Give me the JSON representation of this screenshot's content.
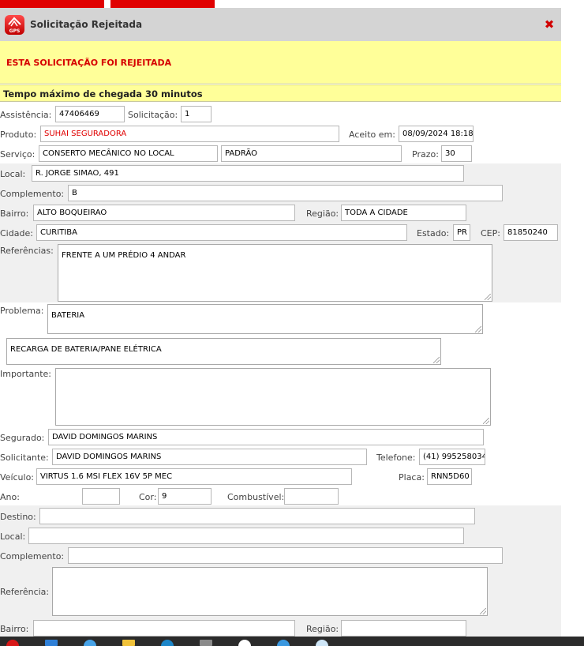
{
  "window": {
    "title": "Solicitação Rejeitada",
    "icon": "gps-app-icon",
    "icon_text": "GPS"
  },
  "alert": "ESTA SOLICITAÇÃO FOI REJEITADA",
  "tempo": "Tempo máximo de chegada 30 minutos",
  "labels": {
    "assistencia": "Assistência:",
    "solicitacao": "Solicitação:",
    "produto": "Produto:",
    "aceito": "Aceito em:",
    "servico": "Serviço:",
    "prazo": "Prazo:",
    "local": "Local:",
    "complemento": "Complemento:",
    "bairro": "Bairro:",
    "regiao": "Região:",
    "cidade": "Cidade:",
    "estado": "Estado:",
    "cep": "CEP:",
    "referencias": "Referências:",
    "problema": "Problema:",
    "importante": "Importante:",
    "segurado": "Segurado:",
    "solicitante": "Solicitante:",
    "telefone": "Telefone:",
    "veiculo": "Veículo:",
    "placa": "Placa:",
    "ano": "Ano:",
    "cor": "Cor:",
    "combustivel": "Combustível:",
    "destino": "Destino:",
    "local2": "Local:",
    "complemento2": "Complemento:",
    "referencia2": "Referência:",
    "bairro2": "Bairro:",
    "regiao2": "Região:"
  },
  "values": {
    "assistencia": "47406469",
    "solicitacao": "1",
    "produto": "SUHAI SEGURADORA",
    "aceito": "08/09/2024 18:18",
    "servico": "CONSERTO MECÂNICO NO LOCAL",
    "servico_tipo": "PADRÃO",
    "prazo": "30",
    "local": "R. JORGE SIMAO, 491",
    "complemento": "B",
    "bairro": "ALTO BOQUEIRAO",
    "regiao": "TODA A CIDADE",
    "cidade": "CURITIBA",
    "estado": "PR",
    "cep": "81850240",
    "referencias": "FRENTE A UM PRÉDIO 4 ANDAR",
    "problema": "BATERIA",
    "problema_detalhe": "RECARGA DE BATERIA/PANE ELÉTRICA",
    "importante": "",
    "segurado": "DAVID DOMINGOS MARINS",
    "solicitante": "DAVID DOMINGOS MARINS",
    "telefone": "(41) 995258034",
    "veiculo": "VIRTUS 1.6 MSI FLEX 16V 5P MEC",
    "placa": "RNN5D60",
    "ano": "",
    "cor": "9",
    "combustivel": "",
    "destino": "",
    "local2": "",
    "complemento2": "",
    "referencia2": "",
    "bairro2": "",
    "regiao2": ""
  },
  "colors": {
    "alert_bg": "#ffff99",
    "alert_text": "#d60000",
    "titlebar": "#d4d4d4",
    "section_gray": "#f0f0f0"
  }
}
